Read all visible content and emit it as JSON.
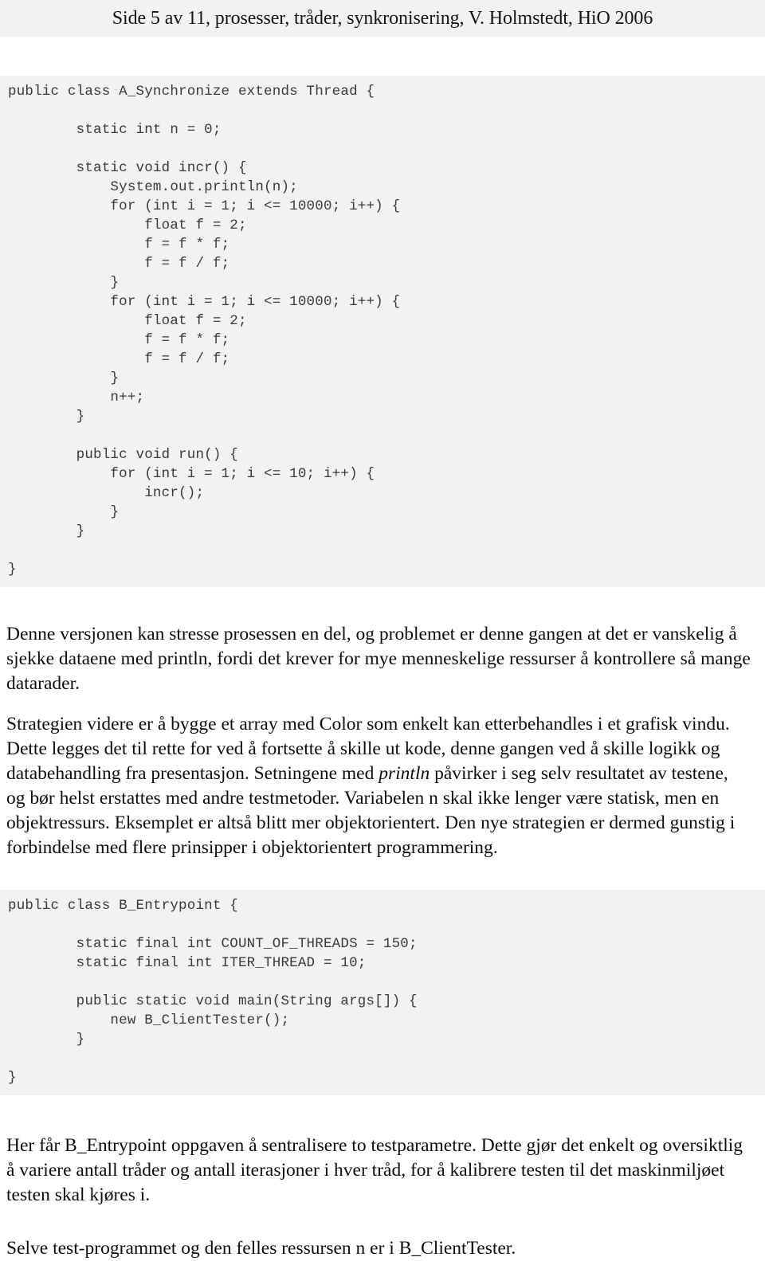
{
  "header": {
    "text": "Side 5 av 11, prosesser, tråder, synkronisering, V. Holmstedt, HiO 2006"
  },
  "code_block_a": {
    "language": "java",
    "lines": [
      "public class A_Synchronize extends Thread {",
      "",
      "        static int n = 0;",
      "",
      "        static void incr() {",
      "            System.out.println(n);",
      "            for (int i = 1; i <= 10000; i++) {",
      "                float f = 2;",
      "                f = f * f;",
      "                f = f / f;",
      "            }",
      "            for (int i = 1; i <= 10000; i++) {",
      "                float f = 2;",
      "                f = f * f;",
      "                f = f / f;",
      "            }",
      "            n++;",
      "        }",
      "",
      "        public void run() {",
      "            for (int i = 1; i <= 10; i++) {",
      "                incr();",
      "            }",
      "        }",
      "",
      "}"
    ]
  },
  "paragraph_1": "Denne versjonen kan stresse prosessen en del, og problemet er denne gangen at det er vanskelig å sjekke dataene med println, fordi det krever for mye menneskelige ressurser å kontrollere så mange datarader.",
  "paragraph_2": {
    "part_1": "Strategien videre er å bygge et array med Color som enkelt kan etterbehandles i et grafisk vindu. Dette legges det til rette for ved å fortsette å skille ut kode, denne gangen ved å skille logikk og databehandling fra presentasjon. Setningene med ",
    "emphasis": "println",
    "part_2": " påvirker i seg selv resultatet av testene, og bør helst erstattes med andre testmetoder. Variabelen n skal ikke lenger være statisk, men en objektressurs. Eksemplet er altså blitt mer objektorientert. Den nye strategien er dermed gunstig i forbindelse med flere prinsipper i objektorientert programmering."
  },
  "code_block_b": {
    "language": "java",
    "lines": [
      "public class B_Entrypoint {",
      "",
      "        static final int COUNT_OF_THREADS = 150;",
      "        static final int ITER_THREAD = 10;",
      "",
      "        public static void main(String args[]) {",
      "            new B_ClientTester();",
      "        }",
      "",
      "}"
    ]
  },
  "paragraph_3": "Her får B_Entrypoint oppgaven å sentralisere to testparametre. Dette gjør det enkelt og oversiktlig å variere antall tråder og antall iterasjoner i hver tråd, for å kalibrere testen til det maskinmiljøet testen skal kjøres i.",
  "paragraph_4": "Selve test-programmet og den felles ressursen n er i B_ClientTester.",
  "colors": {
    "code_background": "#f2f2f2",
    "header_background": "#f2f2f2",
    "page_background": "#ffffff",
    "body_text": "#0d0d0d",
    "code_text": "#3a3a3a"
  }
}
